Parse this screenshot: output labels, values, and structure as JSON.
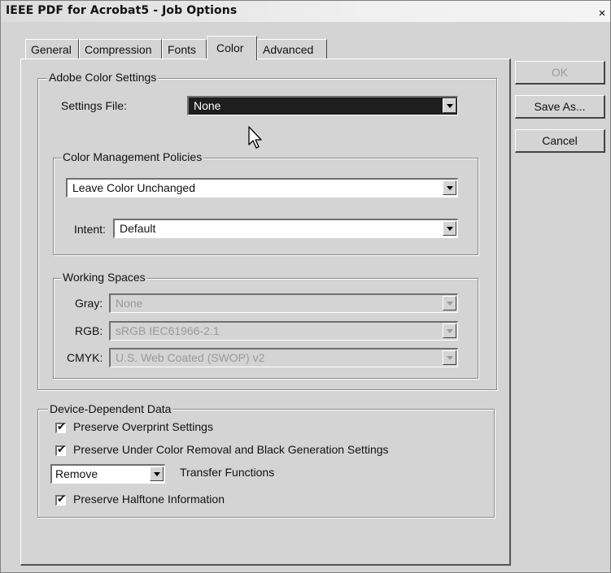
{
  "window": {
    "title": "IEEE PDF for Acrobat5 - Job Options",
    "close_glyph": "×"
  },
  "tabs": [
    {
      "label": "General"
    },
    {
      "label": "Compression"
    },
    {
      "label": "Fonts"
    },
    {
      "label": "Color",
      "active": true
    },
    {
      "label": "Advanced"
    }
  ],
  "adobe_color_settings": {
    "legend": "Adobe Color Settings",
    "settings_file_label": "Settings File:",
    "settings_file_value": "None"
  },
  "color_management_policies": {
    "legend": "Color Management Policies",
    "policy_value": "Leave Color Unchanged",
    "intent_label": "Intent:",
    "intent_value": "Default"
  },
  "working_spaces": {
    "legend": "Working Spaces",
    "gray_label": "Gray:",
    "gray_value": "None",
    "rgb_label": "RGB:",
    "rgb_value": "sRGB IEC61966-2.1",
    "cmyk_label": "CMYK:",
    "cmyk_value": "U.S. Web Coated (SWOP) v2"
  },
  "device_dependent_data": {
    "legend": "Device-Dependent Data",
    "preserve_overprint": {
      "label": "Preserve Overprint Settings",
      "checked": true
    },
    "preserve_ucr": {
      "label": "Preserve Under Color Removal and Black Generation Settings",
      "checked": true
    },
    "transfer_functions_value": "Remove",
    "transfer_functions_label": "Transfer Functions",
    "preserve_halftone": {
      "label": "Preserve Halftone Information",
      "checked": true
    }
  },
  "buttons": {
    "ok": "OK",
    "save_as": "Save As...",
    "cancel": "Cancel"
  },
  "check_glyph": "✔",
  "colors": {
    "background": "#d4d4d4",
    "selected_field": "#1e1e1e",
    "disabled_text": "#9a9a9a"
  }
}
